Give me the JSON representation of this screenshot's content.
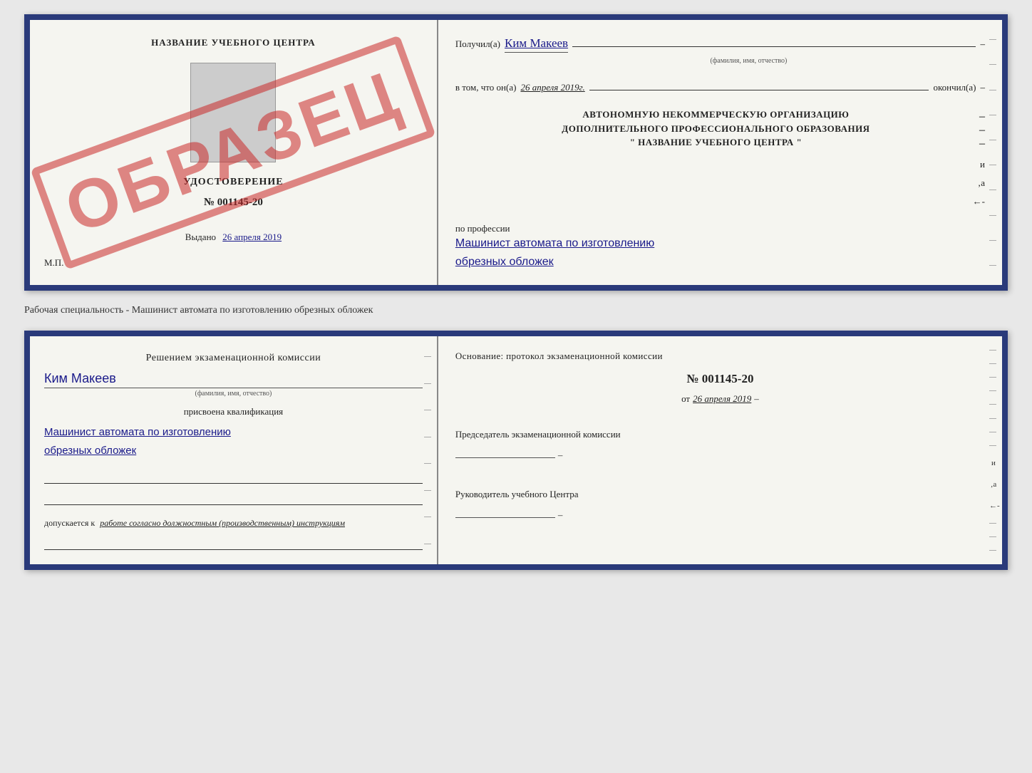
{
  "top_document": {
    "left": {
      "center_title": "НАЗВАНИЕ УЧЕБНОГО ЦЕНТРА",
      "stamp_text": "ОБРАЗЕЦ",
      "doc_type": "УДОСТОВЕРЕНИЕ",
      "doc_number": "№ 001145-20",
      "issued_label": "Выдано",
      "issued_date": "26 апреля 2019",
      "mp_label": "М.П."
    },
    "right": {
      "received_label": "Получил(а)",
      "recipient_name": "Ким Макеев",
      "recipient_sublabel": "(фамилия, имя, отчество)",
      "date_label": "в том, что он(а)",
      "date_value": "26 апреля 2019г.",
      "finished_label": "окончил(а)",
      "org_line1": "АВТОНОМНУЮ НЕКОММЕРЧЕСКУЮ ОРГАНИЗАЦИЮ",
      "org_line2": "ДОПОЛНИТЕЛЬНОГО ПРОФЕССИОНАЛЬНОГО ОБРАЗОВАНИЯ",
      "org_line3": "\"  НАЗВАНИЕ УЧЕБНОГО ЦЕНТРА  \"",
      "profession_label": "по профессии",
      "profession_line1": "Машинист автомата по изготовлению",
      "profession_line2": "обрезных обложек"
    }
  },
  "between_label": "Рабочая специальность - Машинист автомата по изготовлению обрезных обложек",
  "bottom_document": {
    "left": {
      "decision_text": "Решением экзаменационной комиссии",
      "name_handwritten": "Ким Макеев",
      "name_sublabel": "(фамилия, имя, отчество)",
      "qualification_label": "присвоена квалификация",
      "qualification_line1": "Машинист автомата по изготовлению",
      "qualification_line2": "обрезных обложек",
      "admission_label": "допускается к",
      "admission_value": "работе согласно должностным (производственным) инструкциям"
    },
    "right": {
      "basis_title": "Основание: протокол экзаменационной комиссии",
      "protocol_number": "№  001145-20",
      "date_prefix": "от",
      "protocol_date": "26 апреля 2019",
      "chairman_label": "Председатель экзаменационной комиссии",
      "director_label": "Руководитель учебного Центра"
    }
  }
}
